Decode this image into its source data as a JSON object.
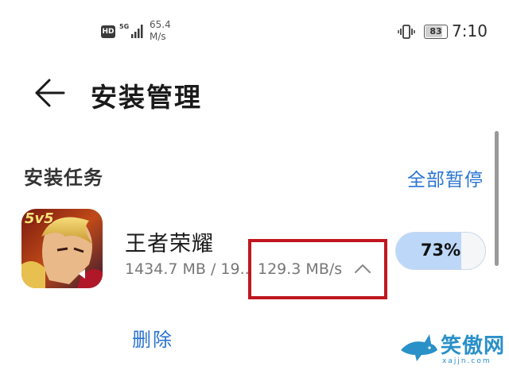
{
  "status_bar": {
    "hd": "HD",
    "network": "5G",
    "speed_value": "65.4",
    "speed_unit": "M/s",
    "battery": "83",
    "battery_level": 0.83,
    "time": "7:10"
  },
  "header": {
    "back_icon": "arrow-left-icon",
    "title": "安装管理"
  },
  "section": {
    "title": "安装任务",
    "pause_all_label": "全部暂停"
  },
  "task": {
    "app_name": "王者荣耀",
    "icon_label": "5v5",
    "size": "1434.7 MB / 19..",
    "speed": "129.3 MB/s",
    "expand_icon": "chevron-up-icon",
    "progress_label": "73%",
    "progress_value": 0.73,
    "delete_label": "删除"
  },
  "watermark": {
    "text": "笑傲网",
    "domain": "xajjn.com"
  },
  "colors": {
    "accent": "#2a74d0",
    "progress_fill": "#bcd7f8",
    "highlight": "#c0161f"
  }
}
